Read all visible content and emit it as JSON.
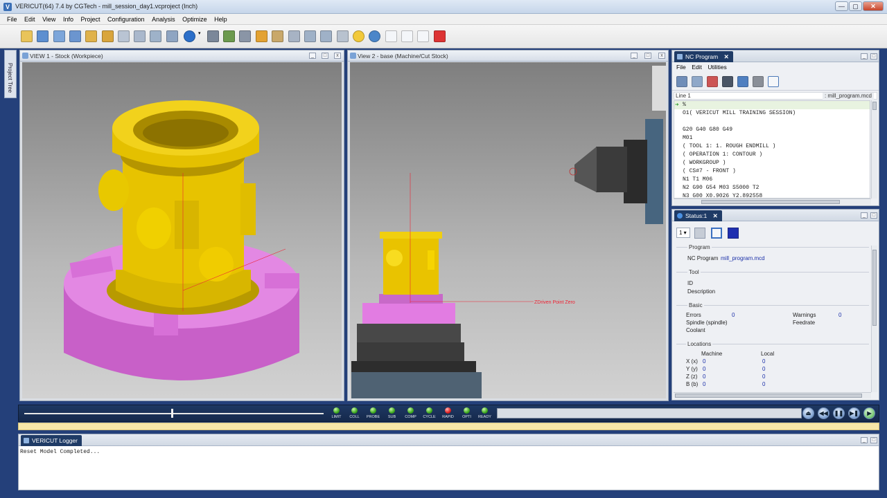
{
  "window": {
    "title": "VERICUT(64)  7.4 by CGTech - mill_session_day1.vcproject (Inch)",
    "min_label": "—",
    "max_label": "▢",
    "close_label": "✕"
  },
  "menu": [
    "File",
    "Edit",
    "View",
    "Info",
    "Project",
    "Configuration",
    "Analysis",
    "Optimize",
    "Help"
  ],
  "left_strip": {
    "label": "Project Tree"
  },
  "view1": {
    "title": "VIEW 1 - Stock (Workpiece)"
  },
  "view2": {
    "title": "View 2 - base (Machine/Cut Stock)",
    "annotation": "ZDriven Point Zero"
  },
  "nc_program": {
    "tab_label": "NC Program",
    "menu": [
      "File",
      "Edit",
      "Utilities"
    ],
    "line_label": "Line 1",
    "file_name": ": mill_program.mcd",
    "lines": [
      "%",
      "O1( VERICUT MILL TRAINING SESSION)",
      "",
      "G20 G40 G80 G49",
      "M01",
      "( TOOL 1: 1. ROUGH ENDMILL )",
      "( OPERATION 1: CONTOUR )",
      "( WORKGROUP )",
      "( CS#7 - FRONT )",
      "N1 T1 M06",
      "N2 G90 G54 M03 S5000 T2",
      "N3 G00 X0.9026 Y2.892558"
    ]
  },
  "status": {
    "tab_label": "Status:1",
    "selector_value": "1",
    "program": {
      "heading": "Program",
      "label": "NC Program",
      "value": "mill_program.mcd"
    },
    "tool": {
      "heading": "Tool",
      "id_label": "ID",
      "description_label": "Description"
    },
    "basic": {
      "heading": "Basic",
      "errors_label": "Errors",
      "errors_value": "0",
      "warnings_label": "Warnings",
      "warnings_value": "0",
      "spindle_label": "Spindle (spindle)",
      "feedrate_label": "Feedrate",
      "coolant_label": "Coolant"
    },
    "locations": {
      "heading": "Locations",
      "machine_header": "Machine",
      "local_header": "Local",
      "rows": [
        {
          "axis": "X (x)",
          "machine": "0",
          "local": "0"
        },
        {
          "axis": "Y (y)",
          "machine": "0",
          "local": "0"
        },
        {
          "axis": "Z (z)",
          "machine": "0",
          "local": "0"
        },
        {
          "axis": "B (b)",
          "machine": "0",
          "local": "0"
        }
      ]
    }
  },
  "playbar": {
    "leds": [
      {
        "label": "LIMIT",
        "color": "green"
      },
      {
        "label": "COLL",
        "color": "green"
      },
      {
        "label": "PROBE",
        "color": "green"
      },
      {
        "label": "SUB",
        "color": "green"
      },
      {
        "label": "COMP",
        "color": "green"
      },
      {
        "label": "CYCLE",
        "color": "green"
      },
      {
        "label": "RAPID",
        "color": "red"
      },
      {
        "label": "OPTI",
        "color": "green"
      },
      {
        "label": "READY",
        "color": "green"
      }
    ]
  },
  "logger": {
    "tab_label": "VERICUT Logger",
    "message": "Reset Model Completed..."
  },
  "colors": {
    "frame": "#24407a",
    "part_yellow": "#e6c400",
    "fixture_pink": "#e07ae0",
    "tab_active": "#1f3b66",
    "value_blue": "#1a2fa8"
  }
}
